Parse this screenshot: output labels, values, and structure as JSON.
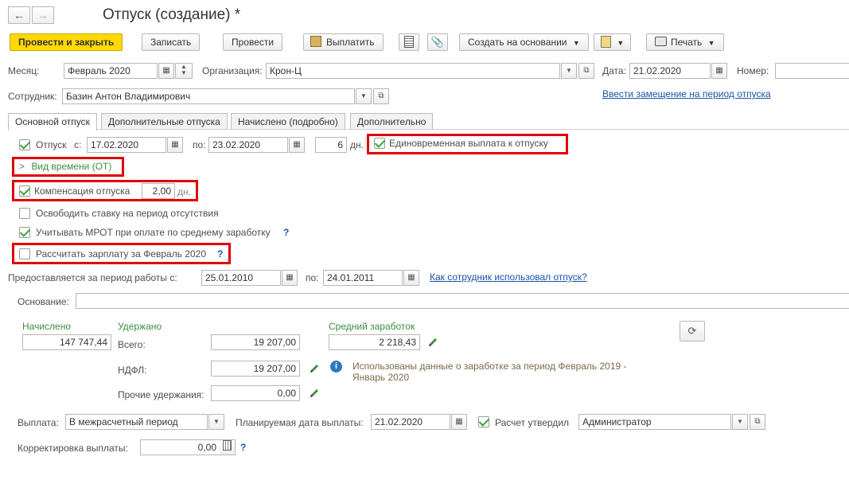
{
  "window": {
    "title": "Отпуск (создание) *"
  },
  "toolbar": {
    "post_close": "Провести и закрыть",
    "save": "Записать",
    "post": "Провести",
    "pay": "Выплатить",
    "create_based": "Создать на основании",
    "print": "Печать"
  },
  "header": {
    "month_label": "Месяц:",
    "month_value": "Февраль 2020",
    "org_label": "Организация:",
    "org_value": "Крон-Ц",
    "date_label": "Дата:",
    "date_value": "21.02.2020",
    "number_label": "Номер:",
    "number_value": "",
    "employee_label": "Сотрудник:",
    "employee_value": "Базин Антон Владимирович",
    "replacement_link": "Ввести замещение на период отпуска"
  },
  "tabs": [
    {
      "label": "Основной отпуск",
      "active": true
    },
    {
      "label": "Дополнительные отпуска",
      "active": false
    },
    {
      "label": "Начислено (подробно)",
      "active": false
    },
    {
      "label": "Дополнительно",
      "active": false
    }
  ],
  "vacation": {
    "checkbox_label": "Отпуск",
    "from_label": "с:",
    "from_value": "17.02.2020",
    "to_label": "по:",
    "to_value": "23.02.2020",
    "days_value": "6",
    "days_unit": "дн.",
    "lump_sum_label": "Единовременная выплата к отпуску",
    "time_type_label": "Вид времени (ОТ)",
    "compensation_label": "Компенсация отпуска",
    "compensation_value": "2,00",
    "compensation_unit": "дн.",
    "free_rate_label": "Освободить ставку на период отсутствия",
    "mrot_label": "Учитывать МРОТ при оплате по среднему заработку",
    "calc_salary_label": "Рассчитать зарплату за Февраль 2020",
    "period_label": "Предоставляется за период работы с:",
    "period_from": "25.01.2010",
    "period_to_label": "по:",
    "period_to": "24.01.2011",
    "usage_link": "Как сотрудник использовал отпуск?",
    "basis_label": "Основание:",
    "basis_value": ""
  },
  "totals": {
    "accrued_label": "Начислено",
    "accrued_value": "147 747,44",
    "withheld_label": "Удержано",
    "total_label": "Всего:",
    "total_value": "19 207,00",
    "ndfl_label": "НДФЛ:",
    "ndfl_value": "19 207,00",
    "other_label": "Прочие удержания:",
    "other_value": "0,00",
    "avg_label": "Средний заработок",
    "avg_value": "2 218,43",
    "info_text_1": "Использованы данные о заработке за период Февраль 2019 -",
    "info_text_2": "Январь 2020"
  },
  "payment": {
    "payout_label": "Выплата:",
    "payout_value": "В межрасчетный период",
    "planned_label": "Планируемая дата выплаты:",
    "planned_value": "21.02.2020",
    "approved_label": "Расчет утвердил",
    "approved_value": "Администратор",
    "correction_label": "Корректировка выплаты:",
    "correction_value": "0,00"
  },
  "colors": {
    "primary_button": "#ffd900",
    "highlight": "#e10000",
    "link": "#1c52a8",
    "check": "#3aa639"
  }
}
